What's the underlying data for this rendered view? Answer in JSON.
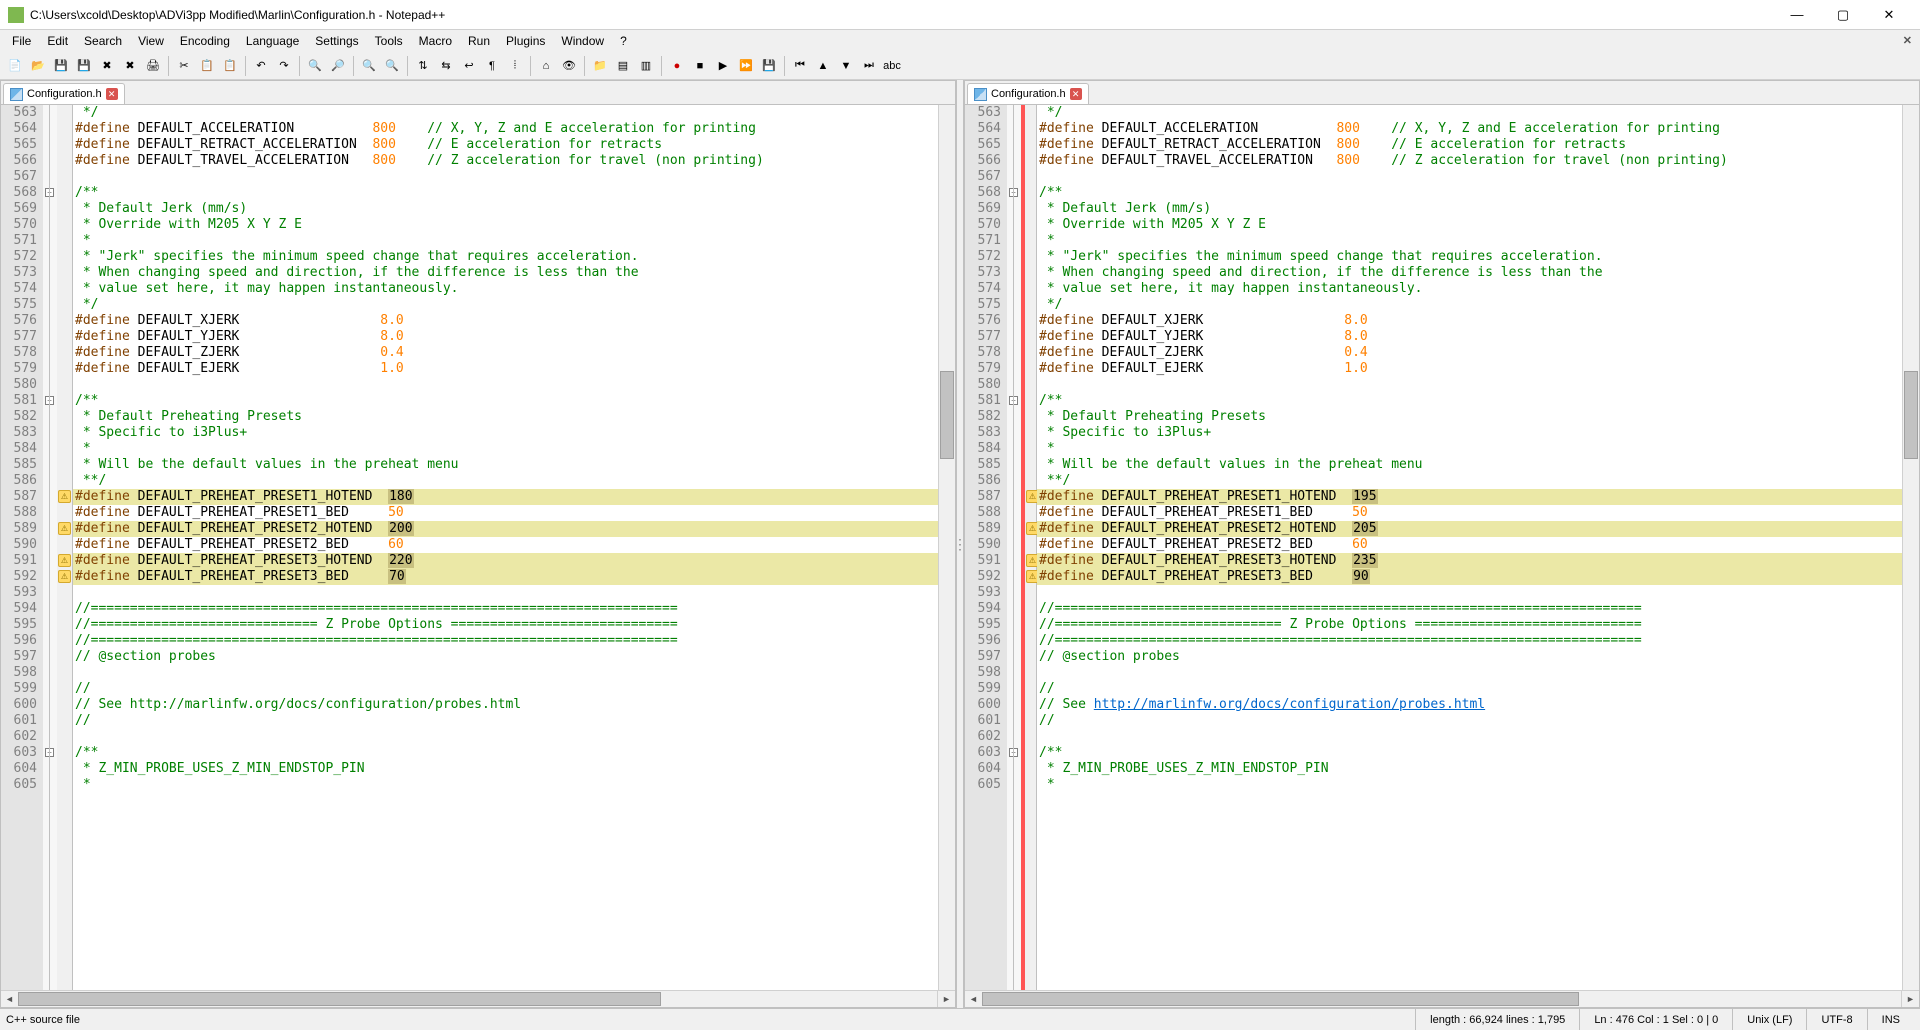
{
  "window": {
    "title": "C:\\Users\\xcold\\Desktop\\ADVi3pp Modified\\Marlin\\Configuration.h - Notepad++"
  },
  "menu": [
    "File",
    "Edit",
    "Search",
    "View",
    "Encoding",
    "Language",
    "Settings",
    "Tools",
    "Macro",
    "Run",
    "Plugins",
    "Window",
    "?"
  ],
  "tabs": {
    "left": "Configuration.h",
    "right": "Configuration.h"
  },
  "lines_start": 563,
  "lines_end": 605,
  "status": {
    "filetype": "C++ source file",
    "length": "length : 66,924    lines : 1,795",
    "pos": "Ln : 476   Col : 1   Sel : 0 | 0",
    "eol": "Unix (LF)",
    "encoding": "UTF-8",
    "mode": "INS"
  },
  "code_common": {
    "563": {
      "type": "comment",
      "text": " */"
    },
    "564": {
      "type": "define",
      "name": "DEFAULT_ACCELERATION",
      "pad": 10,
      "val": "800",
      "comment": "// X, Y, Z and E acceleration for printing"
    },
    "565": {
      "type": "define",
      "name": "DEFAULT_RETRACT_ACCELERATION",
      "pad": 2,
      "val": "800",
      "comment": "// E acceleration for retracts"
    },
    "566": {
      "type": "define",
      "name": "DEFAULT_TRAVEL_ACCELERATION",
      "pad": 3,
      "val": "800",
      "comment": "// Z acceleration for travel (non printing)"
    },
    "567": {
      "type": "blank"
    },
    "568": {
      "type": "comment",
      "text": "/**",
      "fold": true
    },
    "569": {
      "type": "comment",
      "text": " * Default Jerk (mm/s)"
    },
    "570": {
      "type": "comment",
      "text": " * Override with M205 X Y Z E"
    },
    "571": {
      "type": "comment",
      "text": " *"
    },
    "572": {
      "type": "comment",
      "text": " * \"Jerk\" specifies the minimum speed change that requires acceleration."
    },
    "573": {
      "type": "comment",
      "text": " * When changing speed and direction, if the difference is less than the"
    },
    "574": {
      "type": "comment",
      "text": " * value set here, it may happen instantaneously."
    },
    "575": {
      "type": "comment",
      "text": " */"
    },
    "576": {
      "type": "define",
      "name": "DEFAULT_XJERK",
      "pad": 18,
      "val": "8.0"
    },
    "577": {
      "type": "define",
      "name": "DEFAULT_YJERK",
      "pad": 18,
      "val": "8.0"
    },
    "578": {
      "type": "define",
      "name": "DEFAULT_ZJERK",
      "pad": 18,
      "val": "0.4"
    },
    "579": {
      "type": "define",
      "name": "DEFAULT_EJERK",
      "pad": 18,
      "val": "1.0"
    },
    "580": {
      "type": "blank"
    },
    "581": {
      "type": "comment",
      "text": "/**",
      "fold": true
    },
    "582": {
      "type": "comment",
      "text": " * Default Preheating Presets"
    },
    "583": {
      "type": "comment",
      "text": " * Specific to i3Plus+"
    },
    "584": {
      "type": "comment",
      "text": " *"
    },
    "585": {
      "type": "comment",
      "text": " * Will be the default values in the preheat menu"
    },
    "586": {
      "type": "comment",
      "text": " **/"
    },
    "588": {
      "type": "define",
      "name": "DEFAULT_PREHEAT_PRESET1_BED",
      "pad": 5,
      "val": "50"
    },
    "590": {
      "type": "define",
      "name": "DEFAULT_PREHEAT_PRESET2_BED",
      "pad": 5,
      "val": "60"
    },
    "593": {
      "type": "blank"
    },
    "594": {
      "type": "comment",
      "text": "//==========================================================================="
    },
    "595": {
      "type": "comment",
      "text": "//============================= Z Probe Options ============================="
    },
    "596": {
      "type": "comment",
      "text": "//==========================================================================="
    },
    "597": {
      "type": "comment",
      "text": "// @section probes"
    },
    "598": {
      "type": "blank"
    },
    "599": {
      "type": "comment",
      "text": "//"
    },
    "600": {
      "type": "comment_link",
      "prefix": "// See ",
      "link": "http://marlinfw.org/docs/configuration/probes.html"
    },
    "601": {
      "type": "comment",
      "text": "//"
    },
    "602": {
      "type": "blank"
    },
    "603": {
      "type": "comment",
      "text": "/**",
      "fold": true
    },
    "604": {
      "type": "comment",
      "text": " * Z_MIN_PROBE_USES_Z_MIN_ENDSTOP_PIN"
    },
    "605": {
      "type": "comment",
      "text": " *"
    }
  },
  "diff_lines": {
    "left": {
      "587": {
        "name": "DEFAULT_PREHEAT_PRESET1_HOTEND",
        "pad": 2,
        "val": "180",
        "hl": true,
        "mark": true
      },
      "589": {
        "name": "DEFAULT_PREHEAT_PRESET2_HOTEND",
        "pad": 2,
        "val": "200",
        "hl": true,
        "mark": true
      },
      "591": {
        "name": "DEFAULT_PREHEAT_PRESET3_HOTEND",
        "pad": 2,
        "val": "220",
        "hl": true,
        "mark": true
      },
      "592": {
        "name": "DEFAULT_PREHEAT_PRESET3_BED",
        "pad": 5,
        "val": "70",
        "hl": true,
        "mark": true
      }
    },
    "right": {
      "587": {
        "name": "DEFAULT_PREHEAT_PRESET1_HOTEND",
        "pad": 2,
        "val": "195",
        "hl": true,
        "mark": true
      },
      "589": {
        "name": "DEFAULT_PREHEAT_PRESET2_HOTEND",
        "pad": 2,
        "val": "205",
        "hl": true,
        "mark": true
      },
      "591": {
        "name": "DEFAULT_PREHEAT_PRESET3_HOTEND",
        "pad": 2,
        "val": "235",
        "hl": true,
        "mark": true
      },
      "592": {
        "name": "DEFAULT_PREHEAT_PRESET3_BED",
        "pad": 5,
        "val": "90",
        "hl": true,
        "mark": true
      }
    }
  },
  "toolbar_icons": [
    "new",
    "open",
    "save",
    "save-all",
    "close",
    "close-all",
    "print",
    "sep",
    "cut",
    "copy",
    "paste",
    "sep",
    "undo",
    "redo",
    "sep",
    "find",
    "replace",
    "sep",
    "zoom-in",
    "zoom-out",
    "sep",
    "sync-v",
    "sync-h",
    "wrap",
    "show-all",
    "indent-guide",
    "sep",
    "lang",
    "monitor",
    "sep",
    "folder",
    "doc-map",
    "doc-list",
    "sep",
    "record",
    "stop",
    "play",
    "play-multi",
    "save-macro",
    "sep",
    "diff-first",
    "diff-prev",
    "diff-next",
    "diff-last",
    "abc"
  ]
}
